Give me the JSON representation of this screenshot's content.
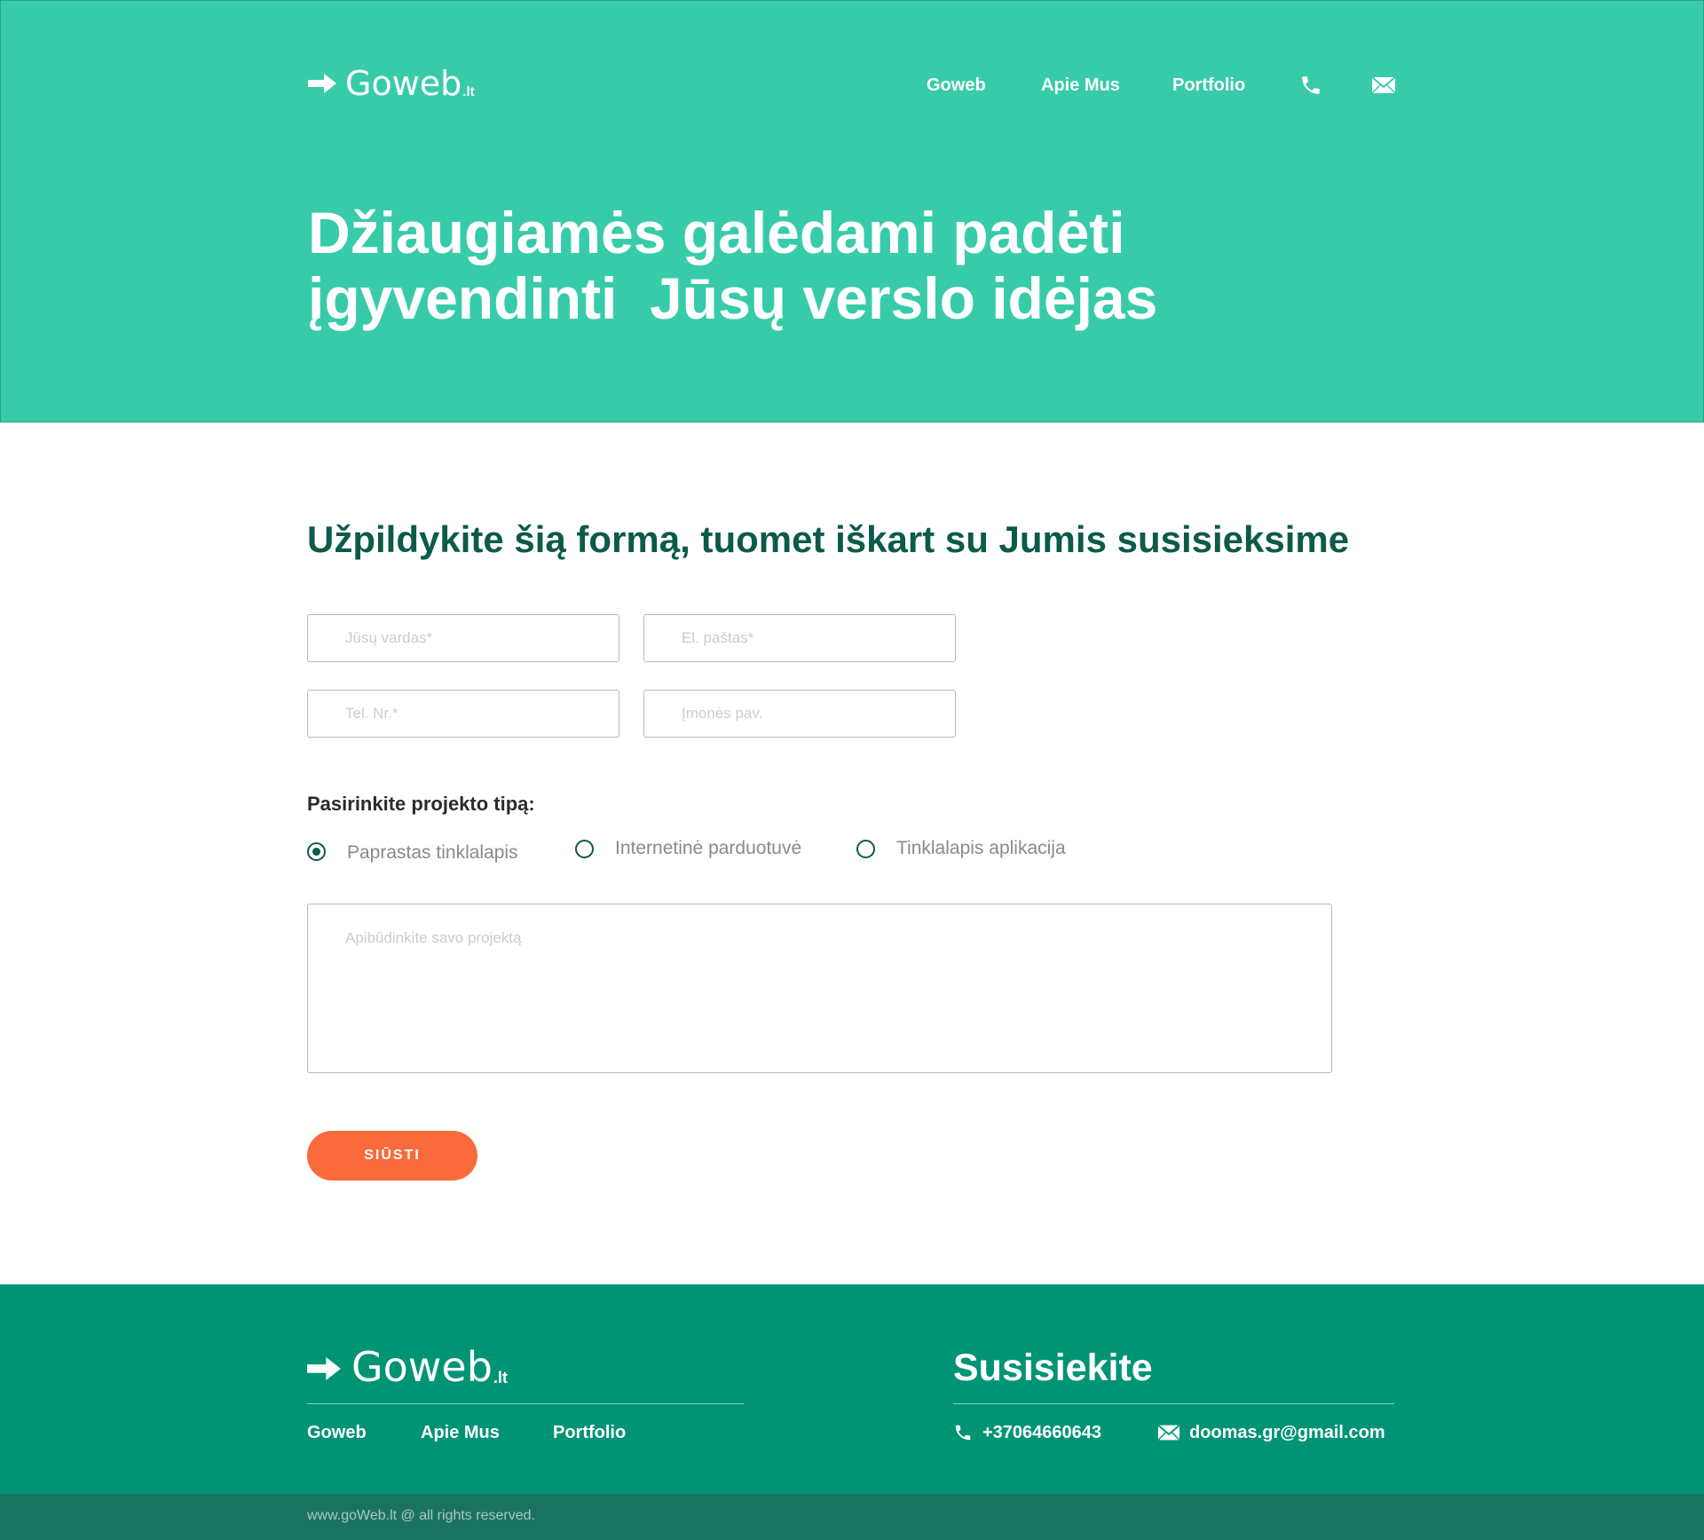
{
  "brand": {
    "name": "Goweb",
    "tld": ".lt",
    "logo_icon": "arrow-right-icon"
  },
  "nav": {
    "items": [
      {
        "label": "Goweb"
      },
      {
        "label": "Apie Mus"
      },
      {
        "label": "Portfolio"
      }
    ],
    "phone_icon": "phone-icon",
    "mail_icon": "mail-icon"
  },
  "hero": {
    "title_line1": "Džiaugiamės galėdami padėti",
    "title_line2": "įgyvendinti  Jūsų verslo idėjas"
  },
  "form": {
    "title": "Užpildykite šią formą, tuomet iškart su Jumis susisieksime",
    "name_placeholder": "Jūsų vardas*",
    "email_placeholder": "El. paštas*",
    "phone_placeholder": "Tel. Nr.*",
    "company_placeholder": "Įmonės pav.",
    "project_type_label": "Pasirinkite projekto tipą:",
    "project_types": [
      {
        "label": "Paprastas tinklalapis",
        "selected": true
      },
      {
        "label": "Internetinė parduotuvė",
        "selected": false
      },
      {
        "label": "Tinklalapis aplikacija",
        "selected": false
      }
    ],
    "description_placeholder": "Apibūdinkite savo projektą",
    "submit_label": "SIŪSTI"
  },
  "footer": {
    "contact_title": "Susisiekite",
    "links": [
      {
        "label": "Goweb"
      },
      {
        "label": "Apie Mus"
      },
      {
        "label": "Portfolio"
      }
    ],
    "phone": "+37064660643",
    "email": "doomas.gr@gmail.com",
    "copyright": "www.goWeb.lt @ all rights reserved."
  },
  "colors": {
    "hero_bg": "#38cbaa",
    "footer_bg": "#009475",
    "bottom_bar_bg": "#1a7360",
    "title_dark_green": "#0c5a4a",
    "button_orange": "#fa6b3c"
  }
}
